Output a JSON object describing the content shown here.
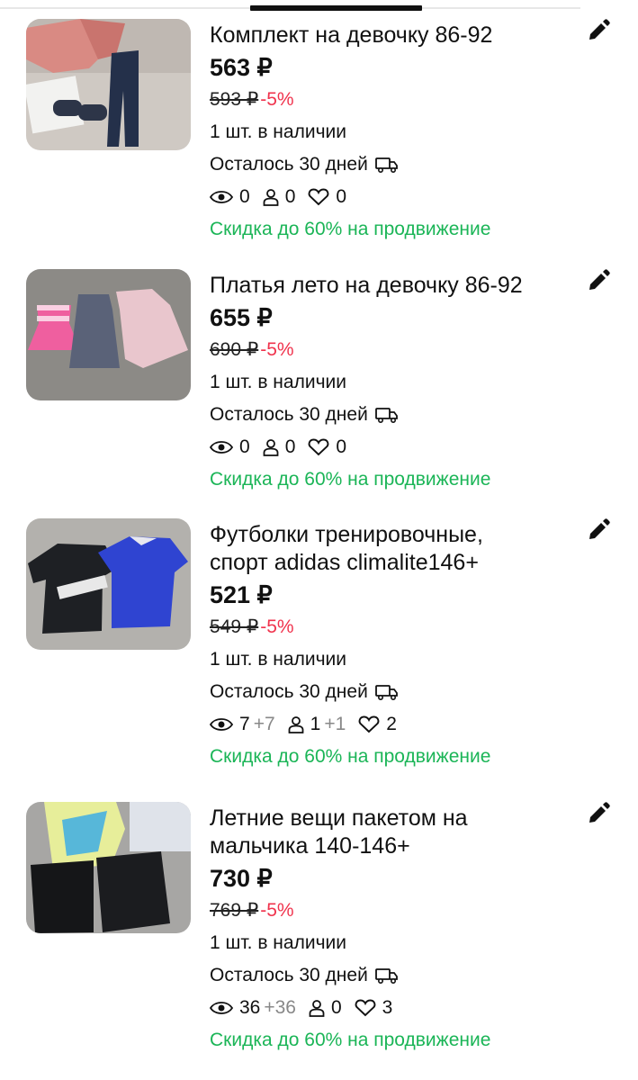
{
  "currency": "₽",
  "listings": [
    {
      "title_lines": [
        "Комплект на девочку 86-92"
      ],
      "price": "563 ₽",
      "old_price": "593 ₽",
      "discount": "-5%",
      "stock": "1 шт. в наличии",
      "days_left": "Осталось 30 дней",
      "views": "0",
      "views_delta": "",
      "contacts": "0",
      "contacts_delta": "",
      "likes": "0",
      "promo": "Скидка до 60% на продвижение"
    },
    {
      "title_lines": [
        "Платья лето на девочку 86-92"
      ],
      "price": "655 ₽",
      "old_price": "690 ₽",
      "discount": "-5%",
      "stock": "1 шт. в наличии",
      "days_left": "Осталось 30 дней",
      "views": "0",
      "views_delta": "",
      "contacts": "0",
      "contacts_delta": "",
      "likes": "0",
      "promo": "Скидка до 60% на продвижение"
    },
    {
      "title_lines": [
        "Футболки тренировочные,",
        "спорт adidas climalite146+"
      ],
      "price": "521 ₽",
      "old_price": "549 ₽",
      "discount": "-5%",
      "stock": "1 шт. в наличии",
      "days_left": "Осталось 30 дней",
      "views": "7",
      "views_delta": "+7",
      "contacts": "1",
      "contacts_delta": "+1",
      "likes": "2",
      "promo": "Скидка до 60% на продвижение"
    },
    {
      "title_lines": [
        "Летние вещи пакетом на",
        "мальчика 140-146+"
      ],
      "price": "730 ₽",
      "old_price": "769 ₽",
      "discount": "-5%",
      "stock": "1 шт. в наличии",
      "days_left": "Осталось 30 дней",
      "views": "36",
      "views_delta": "+36",
      "contacts": "0",
      "contacts_delta": "",
      "likes": "3",
      "promo": "Скидка до 60% на продвижение"
    }
  ],
  "colors": {
    "discount": "#f0334d",
    "promo": "#1bb557",
    "delta": "#888888"
  },
  "icons": [
    "edit-pencil-icon",
    "delivery-truck-icon",
    "eye-icon",
    "person-icon",
    "heart-icon"
  ]
}
